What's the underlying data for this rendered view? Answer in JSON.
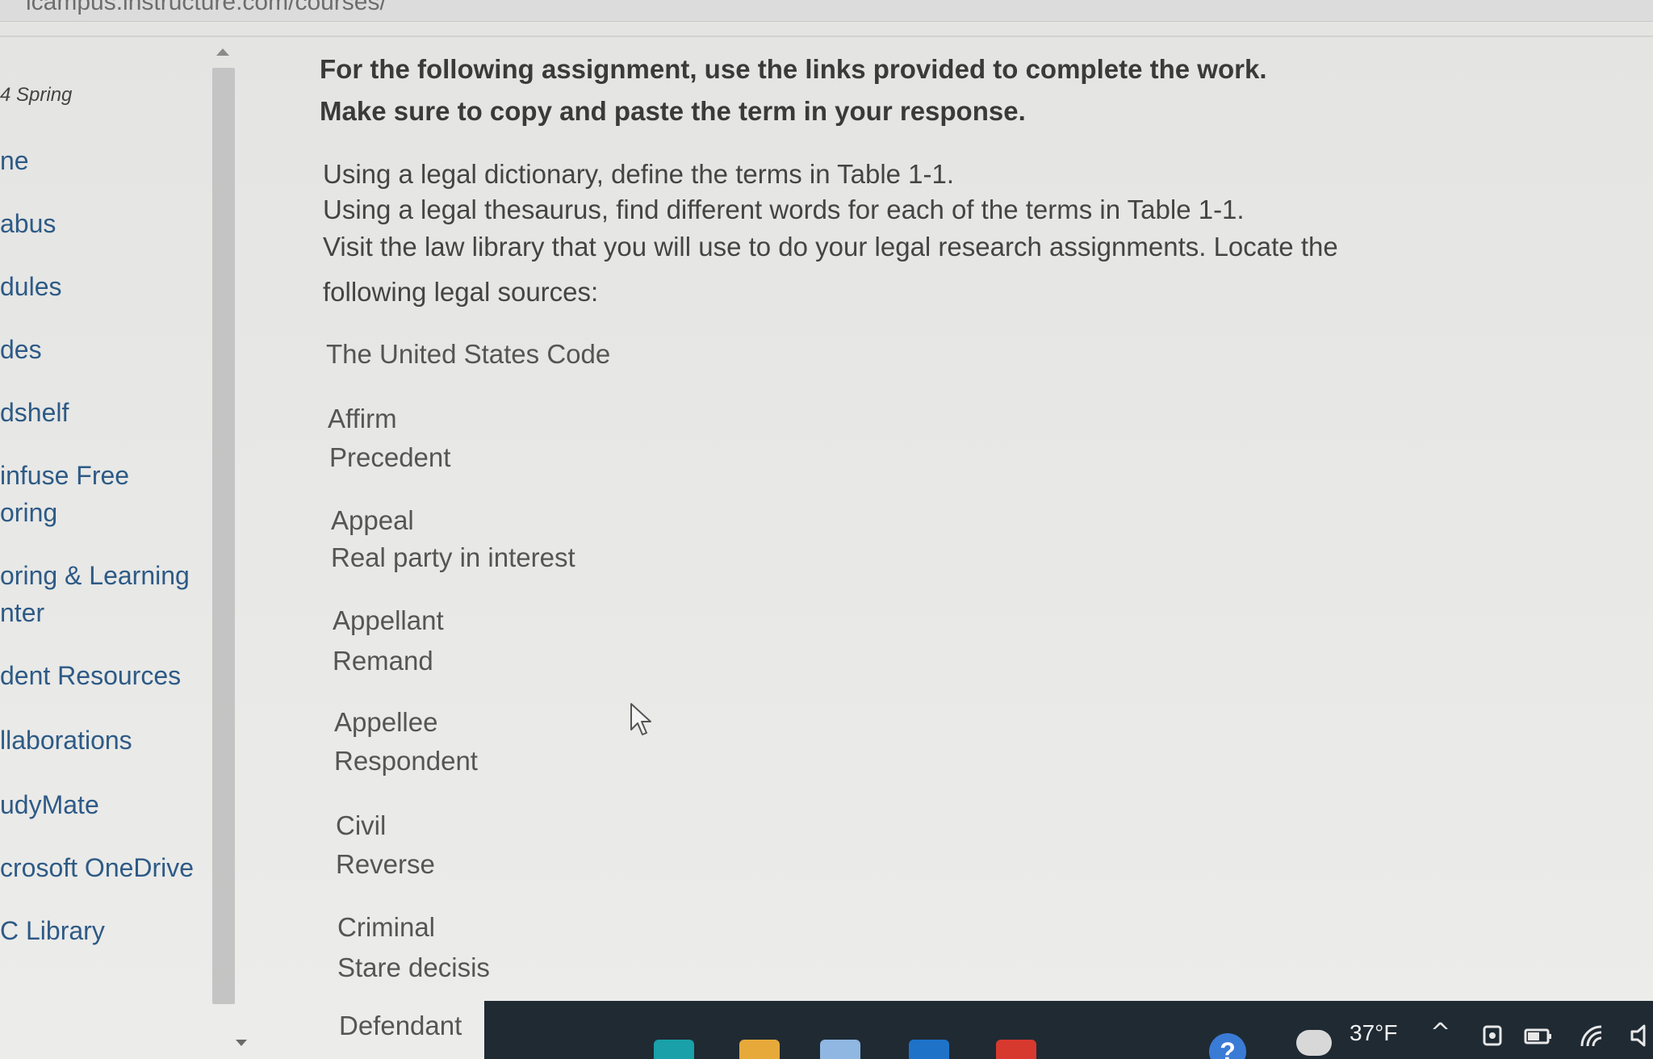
{
  "browser": {
    "url_fragment": "icampus.instructure.com/courses/"
  },
  "course_nav": {
    "term": "4 Spring",
    "items": [
      {
        "label": "ne"
      },
      {
        "label": "abus"
      },
      {
        "label": "dules"
      },
      {
        "label": "des"
      },
      {
        "label": "dshelf"
      },
      {
        "label": "infuse Free"
      },
      {
        "label": "oring"
      },
      {
        "label": "oring & Learning"
      },
      {
        "label": "nter"
      },
      {
        "label": "dent Resources"
      },
      {
        "label": "llaborations"
      },
      {
        "label": "udyMate"
      },
      {
        "label": "crosoft OneDrive"
      },
      {
        "label": "C Library"
      }
    ]
  },
  "assignment": {
    "intro": "For the following assignment, use the links provided to complete the work.  Make sure to copy and paste the term in your response.",
    "instructions": [
      "Using a legal dictionary, define the terms in Table 1-1.",
      "Using a legal thesaurus, find different words for each of the terms in Table 1-1.",
      "Visit the law library that you will use to do your legal research assignments. Locate the",
      "following legal sources:"
    ],
    "source": "The United States Code",
    "terms": [
      "Affirm",
      "Precedent",
      "Appeal",
      "Real party in interest",
      "Appellant",
      "Remand",
      "Appellee",
      "Respondent",
      "Civil",
      "Reverse",
      "Criminal",
      "Stare decisis",
      "Defendant"
    ]
  },
  "taskbar": {
    "help_glyph": "?",
    "temperature": "37°F",
    "chevron_glyph": "^",
    "colors": {
      "background": "#1f2a33",
      "accent_blue": "#3a7bd5"
    }
  }
}
